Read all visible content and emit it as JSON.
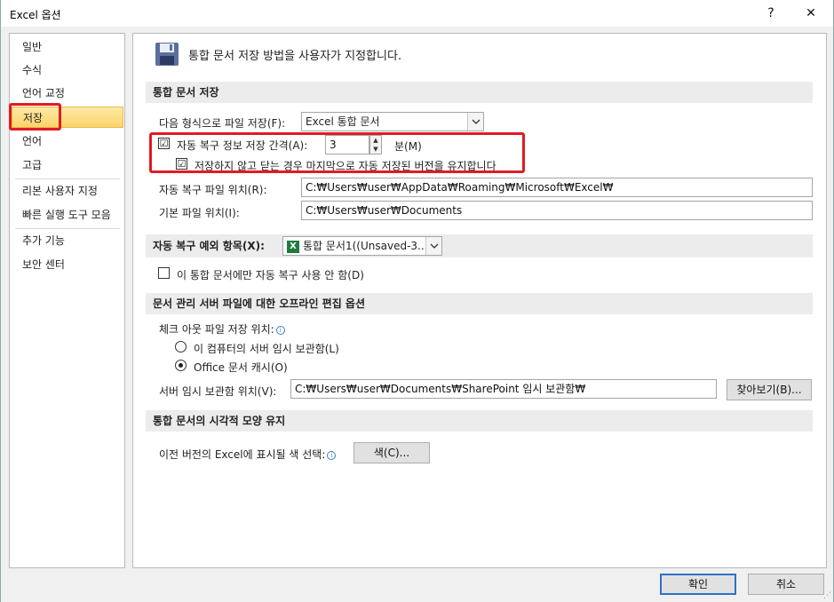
{
  "window": {
    "title": "Excel 옵션",
    "help": "?",
    "close": "✕"
  },
  "sidebar": {
    "items": [
      {
        "label": "일반"
      },
      {
        "label": "수식"
      },
      {
        "label": "언어 교정"
      },
      {
        "label": "저장"
      },
      {
        "label": "언어"
      },
      {
        "label": "고급"
      },
      {
        "label": "리본 사용자 지정"
      },
      {
        "label": "빠른 실행 도구 모음"
      },
      {
        "label": "추가 기능"
      },
      {
        "label": "보안 센터"
      }
    ],
    "selected": "저장"
  },
  "content": {
    "header": "통합 문서 저장 방법을 사용자가 지정합니다.",
    "save_section": {
      "title": "통합 문서 저장",
      "format_label": "다음 형식으로 파일 저장(F):",
      "format_value": "Excel 통합 문서",
      "autorecover_label": "자동 복구 정보 저장 간격(A):",
      "autorecover_checked": "☑",
      "autorecover_minutes": "3",
      "minutes_label": "분(M)",
      "keep_last_label": "저장하지 않고 닫는 경우 마지막으로 자동 저장된 버전을 유지합니다",
      "keep_last_checked": "☑",
      "autorecover_location_label": "자동 복구 파일 위치(R):",
      "autorecover_location_value": "C:₩Users₩user₩AppData₩Roaming₩Microsoft₩Excel₩",
      "default_location_label": "기본 파일 위치(I):",
      "default_location_value": "C:₩Users₩user₩Documents"
    },
    "exceptions_section": {
      "title": "자동 복구 예외 항목(X):",
      "workbook_value": "통합 문서1((Unsaved-3...",
      "disable_label": "이 통합 문서에만 자동 복구 사용 안 함(D)"
    },
    "offline_section": {
      "title": "문서 관리 서버 파일에 대한 오프라인 편집 옵션",
      "checkout_label": "체크 아웃 파일 저장 위치:",
      "radio_server_label": "이 컴퓨터의 서버 임시 보관함(L)",
      "radio_cache_label": "Office 문서 캐시(O)",
      "server_drafts_label": "서버 임시 보관함 위치(V):",
      "server_drafts_value": "C:₩Users₩user₩Documents₩SharePoint 임시 보관함₩",
      "browse_button": "찾아보기(B)..."
    },
    "visual_section": {
      "title": "통합 문서의 시각적 모양 유지",
      "color_label": "이전 버전의 Excel에 표시될 색 선택:",
      "color_button": "색(C)..."
    }
  },
  "footer": {
    "ok": "확인",
    "cancel": "취소"
  },
  "colors": {
    "highlight_box": "#e11b22",
    "selected_nav": "#fbd56b",
    "primary_border": "#2e70c8"
  }
}
